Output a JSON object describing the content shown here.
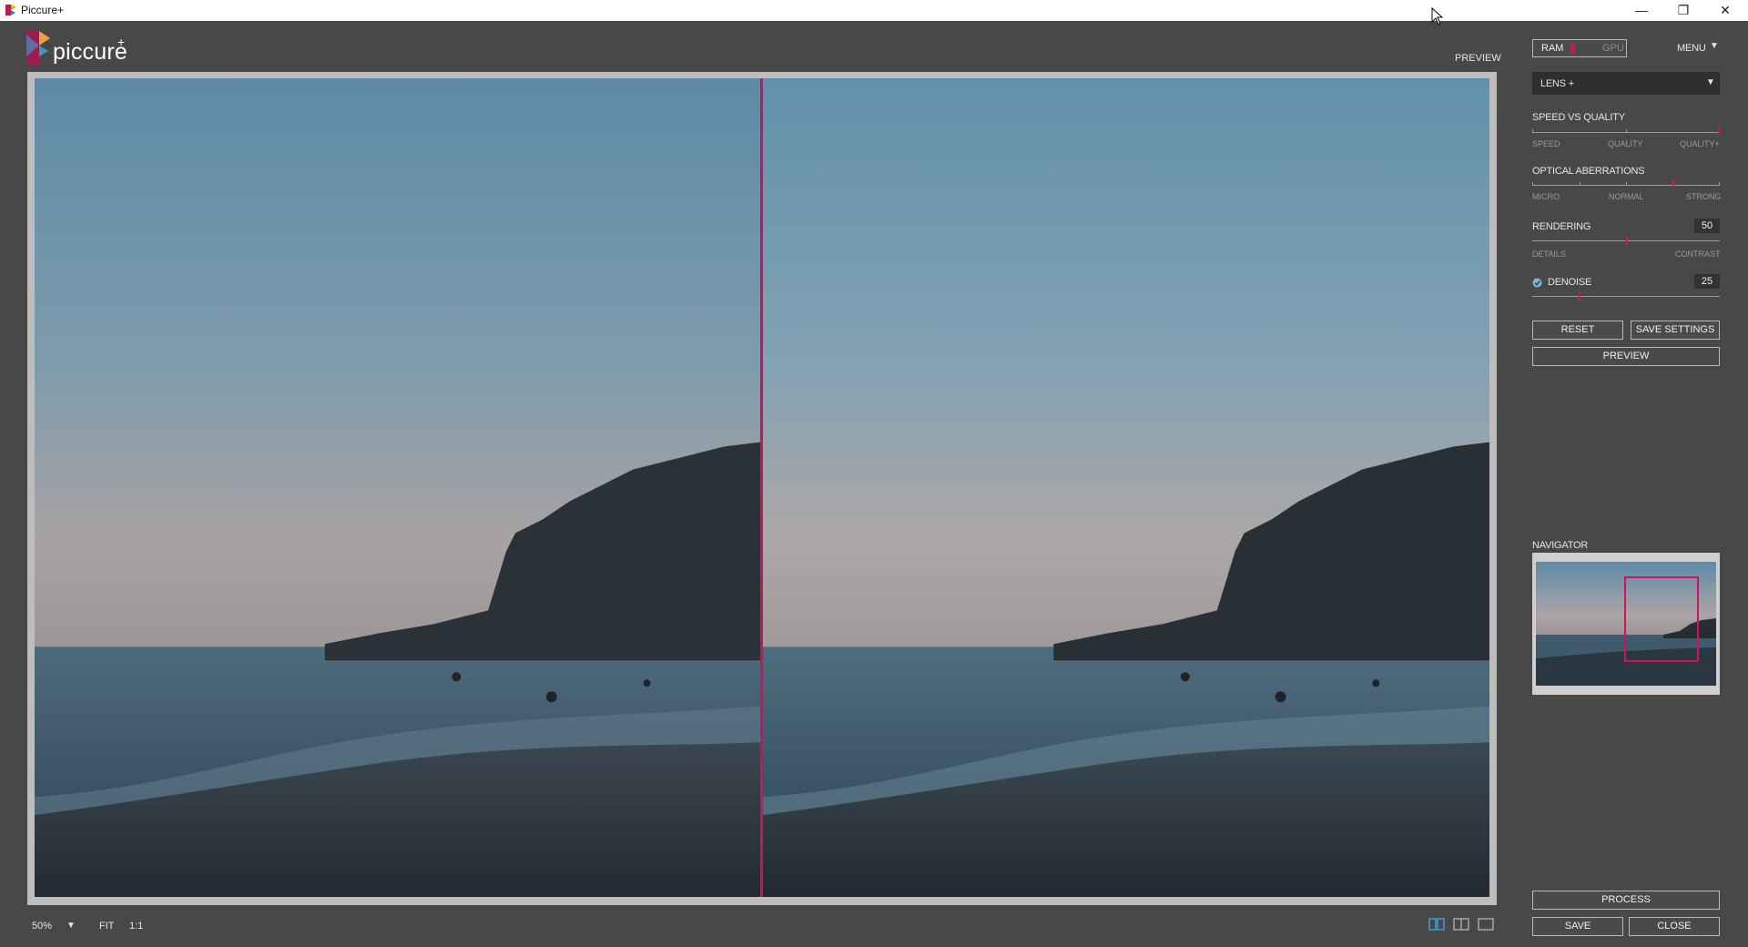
{
  "window": {
    "title": "Piccure+"
  },
  "logo": {
    "wordmark": "piccure",
    "plus": "+"
  },
  "preview_label": "PREVIEW",
  "bottom_bar": {
    "zoom": "50%",
    "fit": "FIT",
    "one_to_one": "1:1"
  },
  "right_panel": {
    "ram": "RAM",
    "gpu": "GPU",
    "menu": "MENU",
    "mode_select": "LENS +",
    "speed_vs_quality": {
      "title": "SPEED VS QUALITY",
      "labels": [
        "SPEED",
        "QUALITY",
        "QUALITY+"
      ],
      "value": 1.0
    },
    "optical_aberrations": {
      "title": "OPTICAL ABERRATIONS",
      "labels": [
        "MICRO",
        "NORMAL",
        "STRONG"
      ],
      "value": 0.75
    },
    "rendering": {
      "title": "RENDERING",
      "value": "50",
      "labels": [
        "DETAILS",
        "CONTRAST"
      ]
    },
    "denoise": {
      "title": "DENOISE",
      "value": "25",
      "checked": true
    },
    "reset": "RESET",
    "save_settings": "SAVE SETTINGS",
    "preview": "PREVIEW",
    "navigator": "NAVIGATOR",
    "process": "PROCESS",
    "save": "SAVE",
    "close": "CLOSE"
  },
  "colors": {
    "accent": "#d0145a",
    "panel_bg": "#484848"
  }
}
